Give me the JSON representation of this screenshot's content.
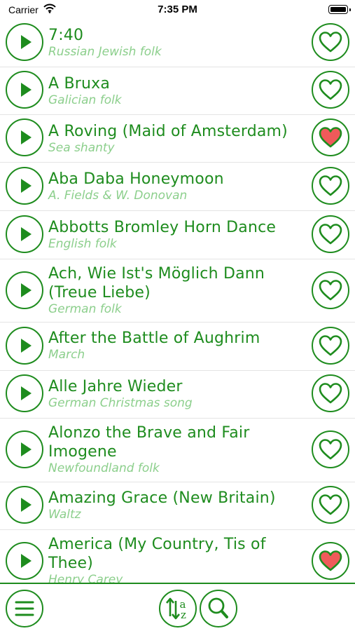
{
  "status_bar": {
    "carrier": "Carrier",
    "time": "7:35 PM"
  },
  "songs": [
    {
      "title": "7:40",
      "subtitle": "Russian Jewish folk",
      "favorite": false
    },
    {
      "title": "A Bruxa",
      "subtitle": "Galician folk",
      "favorite": false
    },
    {
      "title": "A Roving (Maid of Amsterdam)",
      "subtitle": "Sea shanty",
      "favorite": true
    },
    {
      "title": "Aba Daba Honeymoon",
      "subtitle": "A. Fields & W. Donovan",
      "favorite": false
    },
    {
      "title": "Abbotts Bromley Horn Dance",
      "subtitle": "English folk",
      "favorite": false
    },
    {
      "title_line1": "Ach, Wie Ist's Möglich Dann",
      "title_line2": "(Treue Liebe)",
      "subtitle": "German folk",
      "favorite": false
    },
    {
      "title": "After the Battle of Aughrim",
      "subtitle": "March",
      "favorite": false
    },
    {
      "title": "Alle Jahre Wieder",
      "subtitle": "German Christmas song",
      "favorite": false
    },
    {
      "title_line1": "Alonzo the Brave and Fair",
      "title_line2": "Imogene",
      "subtitle": "Newfoundland folk",
      "favorite": false
    },
    {
      "title": "Amazing Grace (New Britain)",
      "subtitle": "Waltz",
      "favorite": false
    },
    {
      "title_line1": "America (My Country, Tis of",
      "title_line2": "Thee)",
      "subtitle": "Henry Carey",
      "favorite": true
    }
  ],
  "toolbar": {
    "menu_icon": "hamburger-menu-icon",
    "sort_icon": "sort-az-icon",
    "sort_letters": "az",
    "search_icon": "magnifier-icon"
  },
  "colors": {
    "accent": "#1e8c1e",
    "subtitle": "#8ccf8c",
    "favorite_fill": "#f05a5a"
  }
}
